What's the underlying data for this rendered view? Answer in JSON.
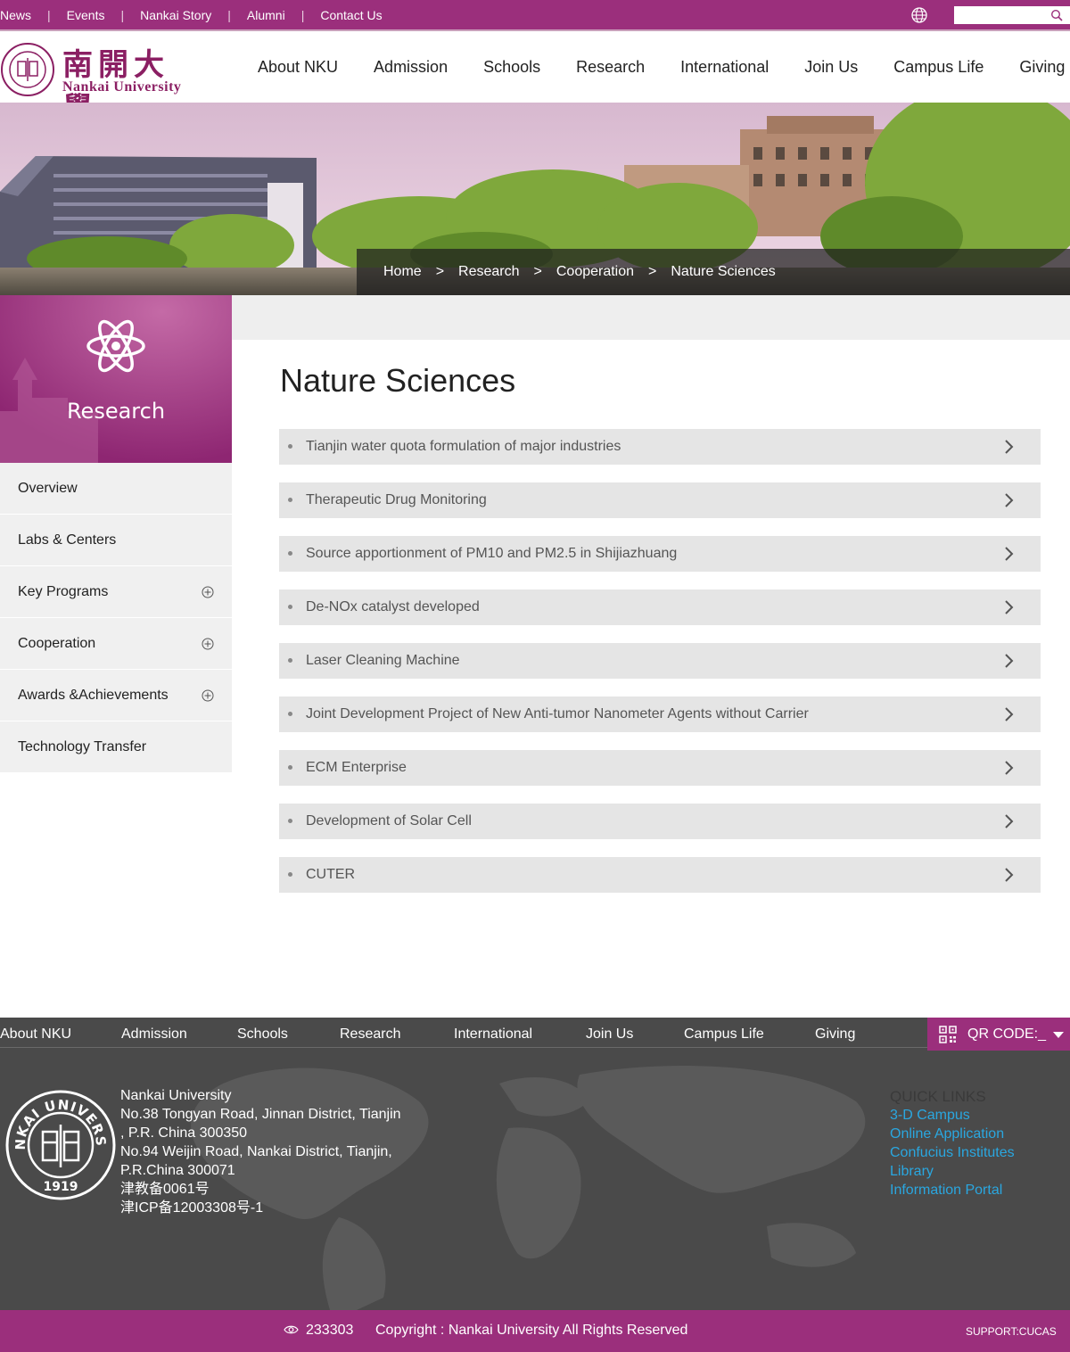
{
  "topbar": {
    "links": [
      "News",
      "Events",
      "Nankai Story",
      "Alumni",
      "Contact Us"
    ],
    "search": {
      "placeholder": "",
      "icon": "search-icon"
    },
    "globe_icon": "globe-icon"
  },
  "header": {
    "logo_cn": "南開大學",
    "logo_en": "Nankai University",
    "nav": [
      "About NKU",
      "Admission",
      "Schools",
      "Research",
      "International",
      "Join Us",
      "Campus Life",
      "Giving"
    ]
  },
  "breadcrumb": {
    "items": [
      "Home",
      "Research",
      "Cooperation",
      "Nature Sciences"
    ],
    "separator": ">"
  },
  "sidebar": {
    "section_title": "Research",
    "section_icon": "atom-icon",
    "items": [
      {
        "label": "Overview",
        "expandable": false
      },
      {
        "label": "Labs & Centers",
        "expandable": false
      },
      {
        "label": "Key Programs",
        "expandable": true
      },
      {
        "label": "Cooperation",
        "expandable": true
      },
      {
        "label": "Awards &Achievements",
        "expandable": true
      },
      {
        "label": "Technology Transfer",
        "expandable": false
      }
    ]
  },
  "main": {
    "title": "Nature Sciences",
    "items": [
      "Tianjin water quota formulation of major industries",
      "Therapeutic Drug Monitoring",
      "Source apportionment of PM10 and PM2.5 in Shijiazhuang",
      "De-NOx catalyst developed",
      "Laser Cleaning Machine",
      "Joint Development Project of New Anti-tumor Nanometer Agents without Carrier",
      "ECM Enterprise",
      "Development of Solar Cell",
      "CUTER"
    ]
  },
  "footer": {
    "nav": [
      "About NKU",
      "Admission",
      "Schools",
      "Research",
      "International",
      "Join Us",
      "Campus Life",
      "Giving"
    ],
    "qr_label": "QR CODE:_",
    "address_lines": [
      "Nankai University",
      "No.38 Tongyan Road, Jinnan District, Tianjin",
      ", P.R. China 300350",
      "No.94 Weijin Road,  Nankai District, Tianjin,",
      "P.R.China  300071",
      "津教备0061号",
      "津ICP备12003308号-1"
    ],
    "quick_links_heading": "QUICK LINKS",
    "quick_links": [
      "3-D Campus",
      "Online Application",
      "Confucius Institutes",
      "Library",
      "Information Portal"
    ],
    "seal_text": "NANKAI UNIVERSITY",
    "seal_year": "1919"
  },
  "bottombar": {
    "visits": "233303",
    "copyright": "Copyright : Nankai University All Rights Reserved",
    "support": "SUPPORT:CUCAS"
  },
  "colors": {
    "brand": "#9b2f7c",
    "footer_bg": "#4a4a4a",
    "link_blue": "#2aa7e0"
  }
}
